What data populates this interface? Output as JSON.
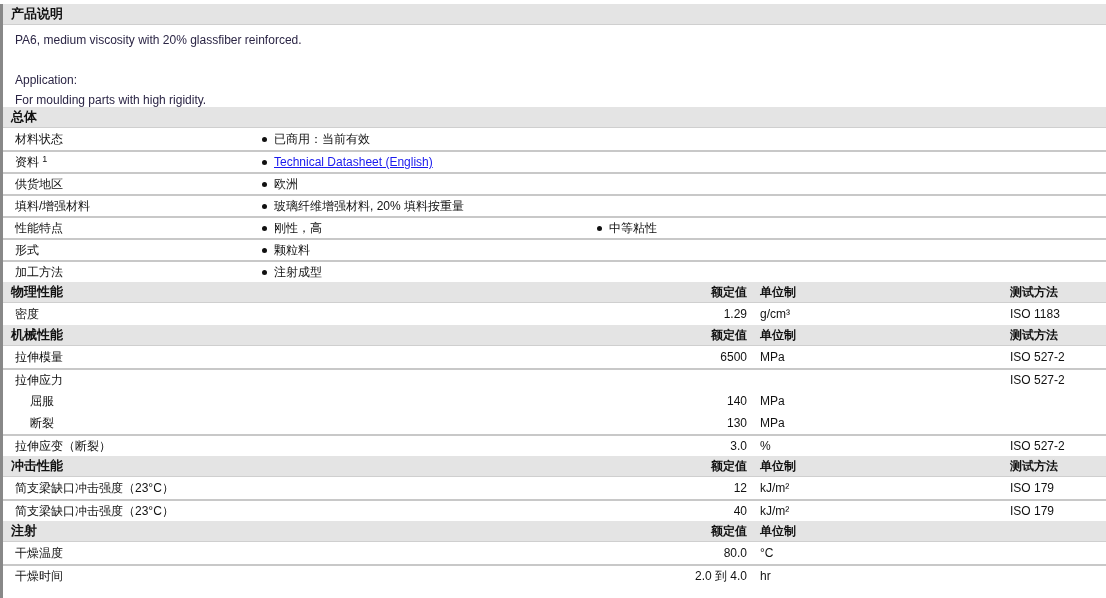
{
  "sections": [
    {
      "kind": "text",
      "title": "产品说明",
      "paragraphs": [
        {
          "lines": [
            "PA6, medium viscosity with 20% glassfiber reinforced."
          ]
        },
        {
          "lines": [
            "Application:",
            "For moulding parts with high rigidity."
          ]
        }
      ]
    },
    {
      "kind": "list",
      "title": "总体",
      "rows": [
        {
          "label": "材料状态",
          "items": [
            {
              "kind": "text",
              "text": "已商用：当前有效"
            }
          ]
        },
        {
          "label": "资料 $^{1}$",
          "items": [
            {
              "kind": "link",
              "text": "Technical Datasheet (English)"
            }
          ]
        },
        {
          "label": "供货地区",
          "items": [
            {
              "kind": "text",
              "text": "欧洲"
            }
          ]
        },
        {
          "label": "填料/增强材料",
          "items": [
            {
              "kind": "text",
              "text": "玻璃纤维增强材料, 20% 填料按重量"
            }
          ]
        },
        {
          "label": "性能特点",
          "items": [
            {
              "kind": "text",
              "text": "刚性，高"
            },
            {
              "kind": "text",
              "text": "中等粘性"
            }
          ]
        },
        {
          "label": "形式",
          "items": [
            {
              "kind": "text",
              "text": "颗粒料"
            }
          ]
        },
        {
          "label": "加工方法",
          "items": [
            {
              "kind": "text",
              "text": "注射成型"
            }
          ]
        }
      ]
    },
    {
      "kind": "props",
      "title": "物理性能",
      "columns": [
        "额定值",
        "单位制",
        "测试方法"
      ],
      "rows": [
        {
          "label": "密度",
          "value": "1.29",
          "unit": "g/cm³",
          "method": "ISO 1183"
        }
      ]
    },
    {
      "kind": "props",
      "title": "机械性能",
      "columns": [
        "额定值",
        "单位制",
        "测试方法"
      ],
      "rows": [
        {
          "label": "拉伸模量",
          "value": "6500",
          "unit": "MPa",
          "method": "ISO 527-2"
        },
        {
          "label": "拉伸应力",
          "method": "ISO 527-2",
          "children": [
            {
              "label": "屈服",
              "value": "140",
              "unit": "MPa"
            },
            {
              "label": "断裂",
              "value": "130",
              "unit": "MPa"
            }
          ]
        },
        {
          "label": "拉伸应变（断裂）",
          "value": "3.0",
          "unit": "%",
          "method": "ISO 527-2"
        }
      ]
    },
    {
      "kind": "props",
      "title": "冲击性能",
      "columns": [
        "额定值",
        "单位制",
        "测试方法"
      ],
      "rows": [
        {
          "label": "简支梁缺口冲击强度（23°C）",
          "value": "12",
          "unit": "kJ/m²",
          "method": "ISO 179"
        },
        {
          "label": "简支梁缺口冲击强度（23°C）",
          "value": "40",
          "unit": "kJ/m²",
          "method": "ISO 179"
        }
      ]
    },
    {
      "kind": "props",
      "title": "注射",
      "columns": [
        "额定值",
        "单位制"
      ],
      "rows": [
        {
          "label": "干燥温度",
          "value": "80.0",
          "unit": "°C"
        },
        {
          "label": "干燥时间",
          "value": "2.0 到 4.0",
          "unit": "hr"
        }
      ]
    }
  ]
}
